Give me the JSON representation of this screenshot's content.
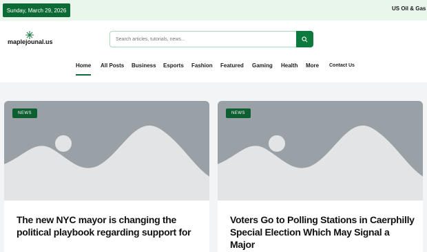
{
  "topbar": {
    "date": "Sunday, March 29, 2026",
    "ticker": "US Oil & Gas Sh"
  },
  "logo": {
    "text": "maplejounal.us"
  },
  "search": {
    "placeholder": "Search articles, tutorials, news..."
  },
  "nav": {
    "items": [
      "Home",
      "All Posts",
      "Business",
      "Esports",
      "Fashion",
      "Featured",
      "Gaming",
      "Health",
      "More",
      "Contact Us"
    ],
    "active": "Home"
  },
  "cards": [
    {
      "tag": "NEWS",
      "title": "The new NYC mayor is changing the political playbook regarding support for"
    },
    {
      "tag": "NEWS",
      "title": "Voters Go to Polling Stations in Caerphilly Special Election Which May Signal a Major"
    }
  ],
  "colors": {
    "accent": "#0c6b34",
    "topbar_bg": "#e9f6ec",
    "placeholder_bg": "#9aa1a6"
  }
}
